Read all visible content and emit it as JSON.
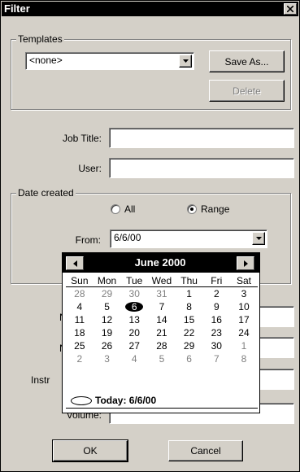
{
  "window": {
    "title": "Filter"
  },
  "templates": {
    "group_label": "Templates",
    "selected": "<none>",
    "save_as": "Save As...",
    "delete": "Delete"
  },
  "fields": {
    "job_title_label": "Job Title:",
    "job_title_value": "",
    "user_label": "User:",
    "user_value": "",
    "volume_label": "Volume:",
    "volume_value": "",
    "partial_label_1": "N",
    "partial_label_2": "N",
    "partial_label_3": "Instr"
  },
  "date_created": {
    "group_label": "Date created",
    "radio_all": "All",
    "radio_range": "Range",
    "selected": "Range",
    "from_label": "From:",
    "from_value": "6/6/00"
  },
  "calendar": {
    "month_title": "June 2000",
    "days_of_week": [
      "Sun",
      "Mon",
      "Tue",
      "Wed",
      "Thu",
      "Fri",
      "Sat"
    ],
    "weeks": [
      [
        "28",
        "29",
        "30",
        "31",
        "1",
        "2",
        "3"
      ],
      [
        "4",
        "5",
        "6",
        "7",
        "8",
        "9",
        "10"
      ],
      [
        "11",
        "12",
        "13",
        "14",
        "15",
        "16",
        "17"
      ],
      [
        "18",
        "19",
        "20",
        "21",
        "22",
        "23",
        "24"
      ],
      [
        "25",
        "26",
        "27",
        "28",
        "29",
        "30",
        "1"
      ],
      [
        "2",
        "3",
        "4",
        "5",
        "6",
        "7",
        "8"
      ]
    ],
    "muted_cells": [
      [
        0,
        0
      ],
      [
        0,
        1
      ],
      [
        0,
        2
      ],
      [
        0,
        3
      ],
      [
        4,
        6
      ],
      [
        5,
        0
      ],
      [
        5,
        1
      ],
      [
        5,
        2
      ],
      [
        5,
        3
      ],
      [
        5,
        4
      ],
      [
        5,
        5
      ],
      [
        5,
        6
      ]
    ],
    "selected_cell": [
      1,
      2
    ],
    "today_text": "Today: 6/6/00"
  },
  "footer": {
    "ok": "OK",
    "cancel": "Cancel"
  },
  "colors": {
    "face": "#d4d0c8",
    "shadow": "#808080",
    "titlebar": "#000000"
  }
}
